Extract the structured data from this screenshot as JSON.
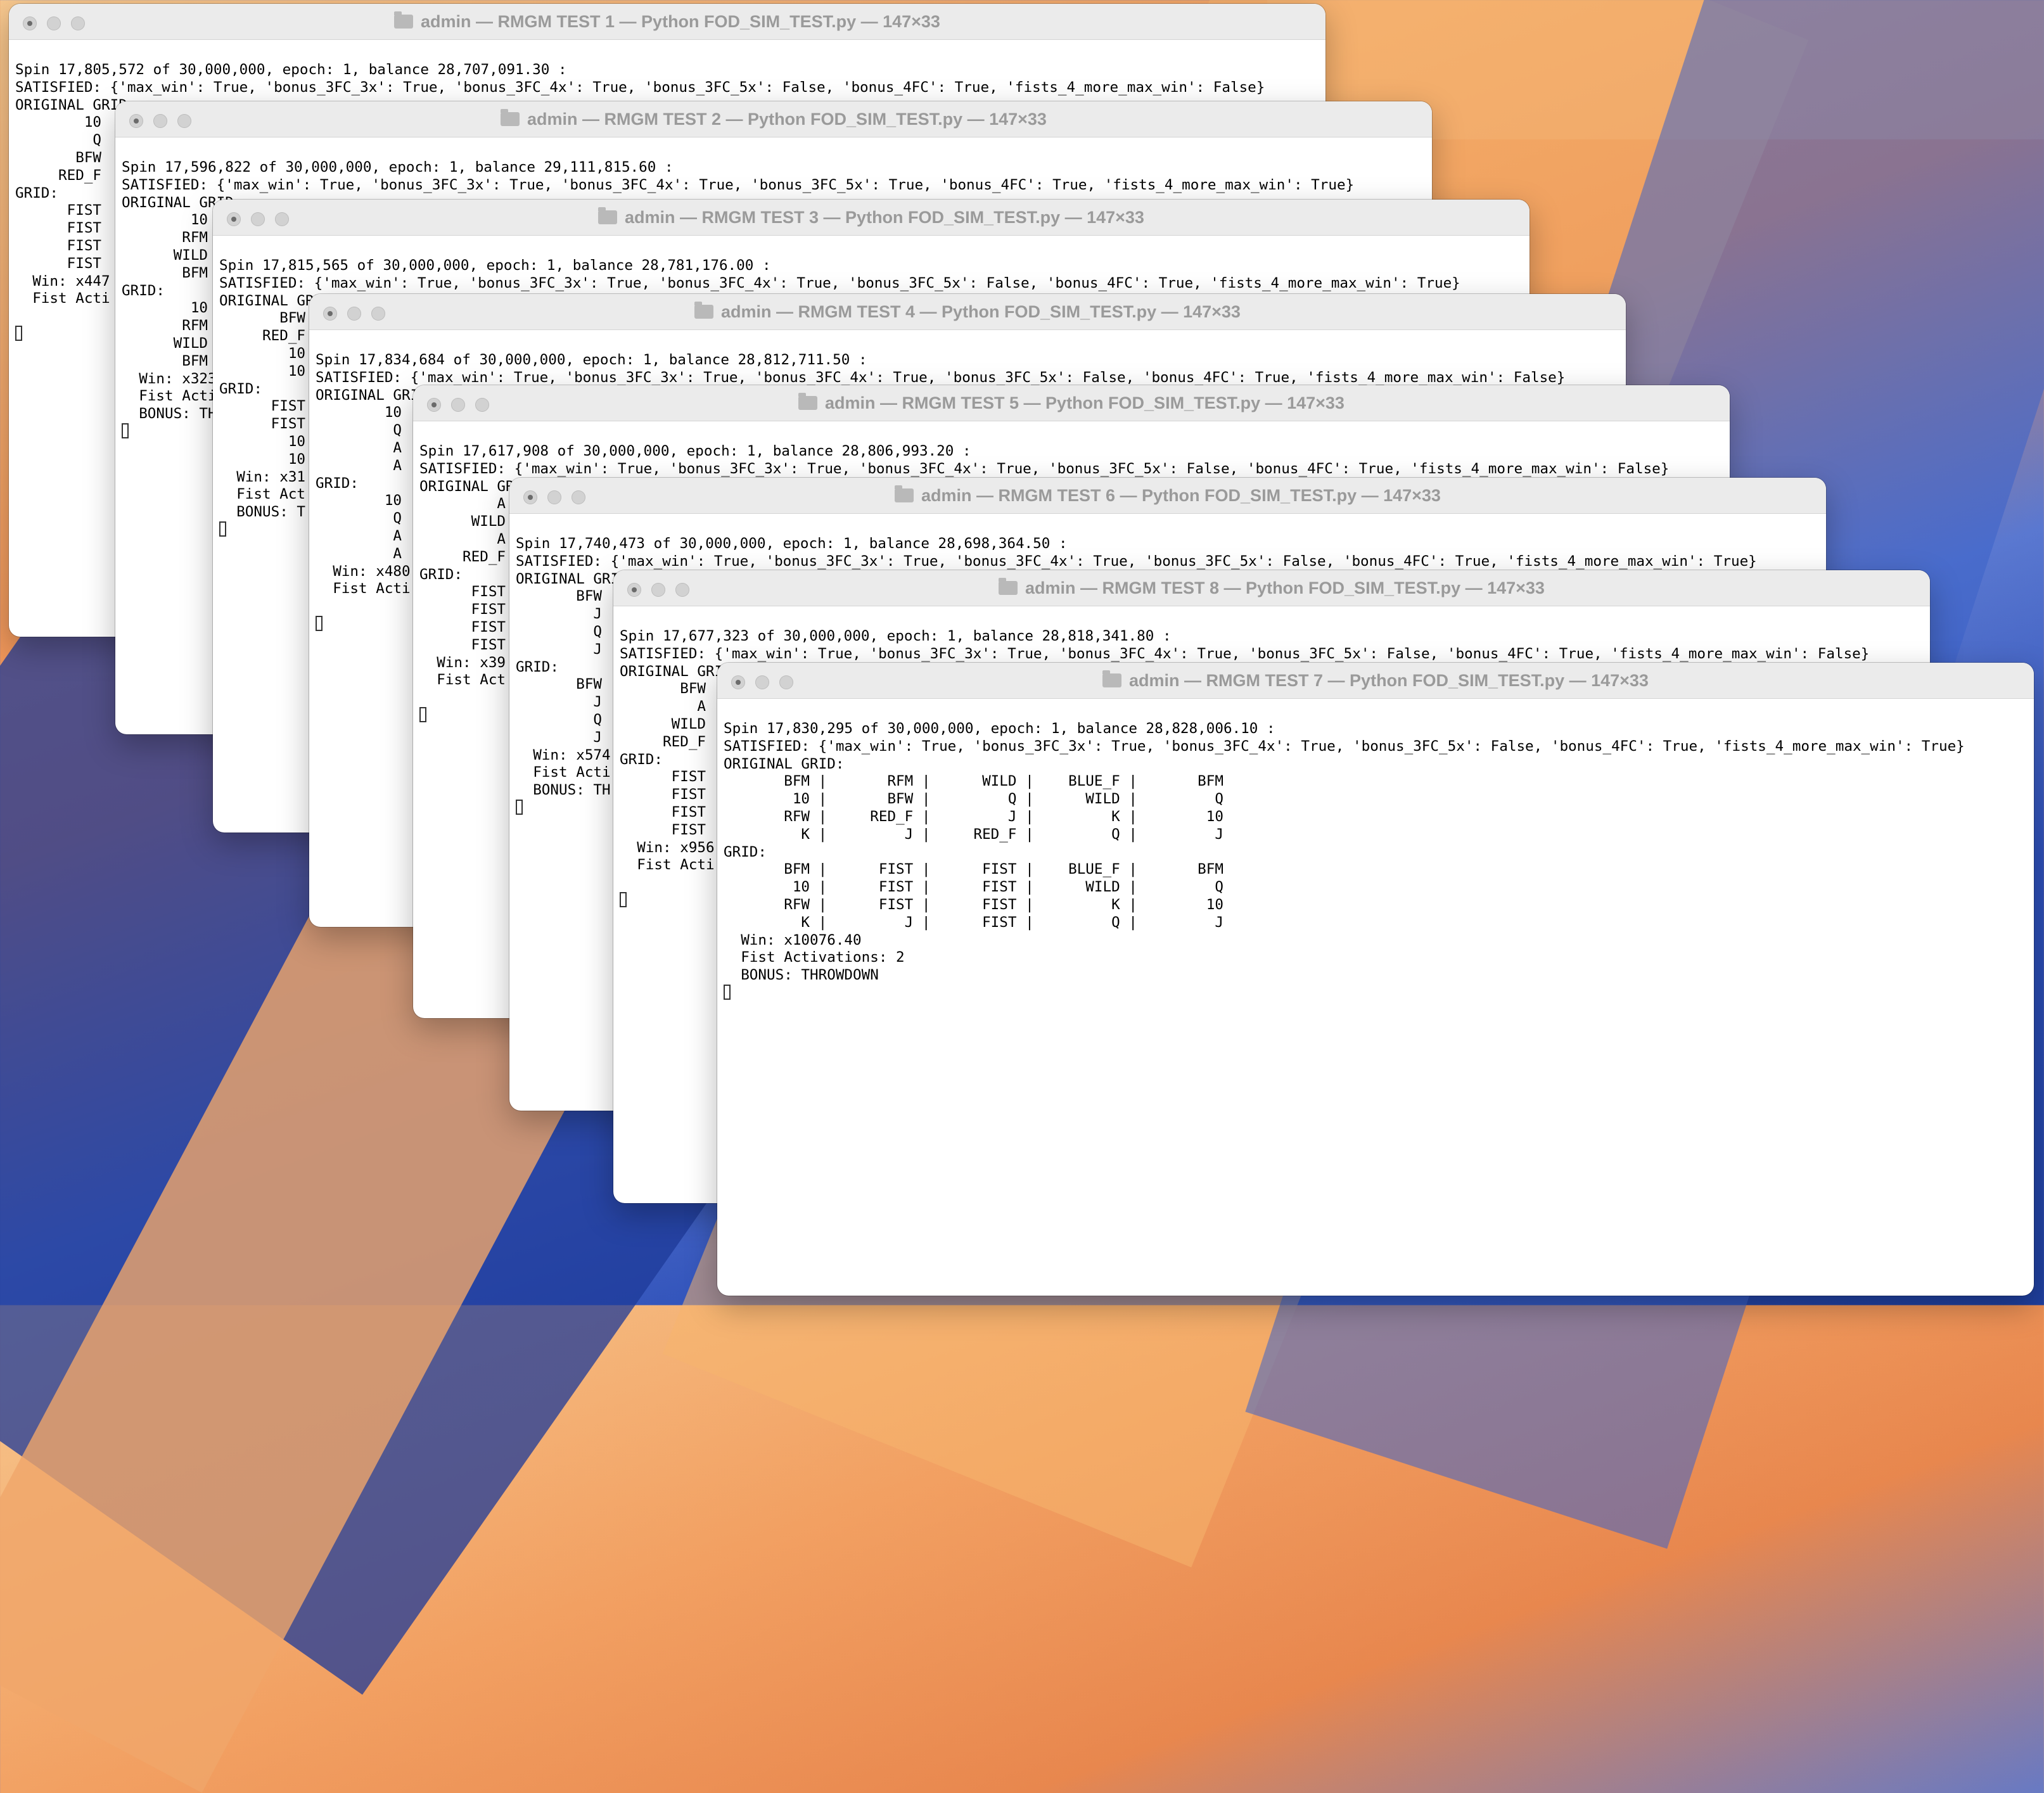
{
  "windows": [
    {
      "title": "admin — RMGM TEST 1 — Python FOD_SIM_TEST.py — 147×33",
      "lines": [
        "Spin 17,805,572 of 30,000,000, epoch: 1, balance 28,707,091.30 :",
        "SATISFIED: {'max_win': True, 'bonus_3FC_3x': True, 'bonus_3FC_4x': True, 'bonus_3FC_5x': False, 'bonus_4FC': True, 'fists_4_more_max_win': False}",
        "ORIGINAL GRID:",
        "        10",
        "         Q",
        "       BFW",
        "     RED_F",
        "GRID:",
        "      FIST",
        "      FIST",
        "      FIST",
        "      FIST",
        "  Win: x447",
        "  Fist Acti",
        "",
        ""
      ]
    },
    {
      "title": "admin — RMGM TEST 2 — Python FOD_SIM_TEST.py — 147×33",
      "lines": [
        "Spin 17,596,822 of 30,000,000, epoch: 1, balance 29,111,815.60 :",
        "SATISFIED: {'max_win': True, 'bonus_3FC_3x': True, 'bonus_3FC_4x': True, 'bonus_3FC_5x': True, 'bonus_4FC': True, 'fists_4_more_max_win': True}",
        "ORIGINAL GRID:",
        "        10",
        "       RFM",
        "      WILD",
        "       BFM",
        "GRID:",
        "        10",
        "       RFM",
        "      WILD",
        "       BFM",
        "  Win: x323",
        "  Fist Acti",
        "  BONUS: TH",
        ""
      ]
    },
    {
      "title": "admin — RMGM TEST 3 — Python FOD_SIM_TEST.py — 147×33",
      "lines": [
        "Spin 17,815,565 of 30,000,000, epoch: 1, balance 28,781,176.00 :",
        "SATISFIED: {'max_win': True, 'bonus_3FC_3x': True, 'bonus_3FC_4x': True, 'bonus_3FC_5x': False, 'bonus_4FC': True, 'fists_4_more_max_win': True}",
        "ORIGINAL GRID:",
        "       BFW",
        "     RED_F",
        "        10",
        "        10",
        "GRID:",
        "      FIST",
        "      FIST",
        "        10",
        "        10",
        "  Win: x31",
        "  Fist Act",
        "  BONUS: T",
        ""
      ]
    },
    {
      "title": "admin — RMGM TEST 4 — Python FOD_SIM_TEST.py — 147×33",
      "lines": [
        "Spin 17,834,684 of 30,000,000, epoch: 1, balance 28,812,711.50 :",
        "SATISFIED: {'max_win': True, 'bonus_3FC_3x': True, 'bonus_3FC_4x': True, 'bonus_3FC_5x': False, 'bonus_4FC': True, 'fists_4_more_max_win': False}",
        "ORIGINAL GRID:",
        "        10",
        "         Q",
        "         A",
        "         A",
        "GRID:",
        "        10",
        "         Q",
        "         A",
        "         A",
        "  Win: x480",
        "  Fist Acti",
        "",
        ""
      ]
    },
    {
      "title": "admin — RMGM TEST 5 — Python FOD_SIM_TEST.py — 147×33",
      "lines": [
        "Spin 17,617,908 of 30,000,000, epoch: 1, balance 28,806,993.20 :",
        "SATISFIED: {'max_win': True, 'bonus_3FC_3x': True, 'bonus_3FC_4x': True, 'bonus_3FC_5x': False, 'bonus_4FC': True, 'fists_4_more_max_win': False}",
        "ORIGINAL GRID:",
        "         A",
        "      WILD",
        "         A",
        "     RED_F",
        "GRID:",
        "      FIST",
        "      FIST",
        "      FIST",
        "      FIST",
        "  Win: x39",
        "  Fist Act",
        "",
        ""
      ]
    },
    {
      "title": "admin — RMGM TEST 6 — Python FOD_SIM_TEST.py — 147×33",
      "lines": [
        "Spin 17,740,473 of 30,000,000, epoch: 1, balance 28,698,364.50 :",
        "SATISFIED: {'max_win': True, 'bonus_3FC_3x': True, 'bonus_3FC_4x': True, 'bonus_3FC_5x': False, 'bonus_4FC': True, 'fists_4_more_max_win': True}",
        "ORIGINAL GRID:",
        "       BFW",
        "         J",
        "         Q",
        "         J",
        "GRID:",
        "       BFW",
        "         J",
        "         Q",
        "         J",
        "  Win: x574",
        "  Fist Acti",
        "  BONUS: TH",
        ""
      ]
    },
    {
      "title": "admin — RMGM TEST 8 — Python FOD_SIM_TEST.py — 147×33",
      "lines": [
        "Spin 17,677,323 of 30,000,000, epoch: 1, balance 28,818,341.80 :",
        "SATISFIED: {'max_win': True, 'bonus_3FC_3x': True, 'bonus_3FC_4x': True, 'bonus_3FC_5x': False, 'bonus_4FC': True, 'fists_4_more_max_win': False}",
        "ORIGINAL GRID:",
        "       BFW",
        "         A",
        "      WILD",
        "     RED_F",
        "GRID:",
        "      FIST",
        "      FIST",
        "      FIST",
        "      FIST",
        "  Win: x956",
        "  Fist Acti",
        "",
        ""
      ]
    },
    {
      "title": "admin — RMGM TEST 7 — Python FOD_SIM_TEST.py — 147×33",
      "lines": [
        "Spin 17,830,295 of 30,000,000, epoch: 1, balance 28,828,006.10 :",
        "SATISFIED: {'max_win': True, 'bonus_3FC_3x': True, 'bonus_3FC_4x': True, 'bonus_3FC_5x': False, 'bonus_4FC': True, 'fists_4_more_max_win': True}",
        "ORIGINAL GRID:",
        "       BFM |       RFM |      WILD |    BLUE_F |       BFM",
        "        10 |       BFW |         Q |      WILD |         Q",
        "       RFW |     RED_F |         J |         K |        10",
        "         K |         J |     RED_F |         Q |         J",
        "GRID:",
        "       BFM |      FIST |      FIST |    BLUE_F |       BFM",
        "        10 |      FIST |      FIST |      WILD |         Q",
        "       RFW |      FIST |      FIST |         K |        10",
        "         K |         J |      FIST |         Q |         J",
        "  Win: x10076.40",
        "  Fist Activations: 2",
        "  BONUS: THROWDOWN",
        ""
      ]
    }
  ]
}
